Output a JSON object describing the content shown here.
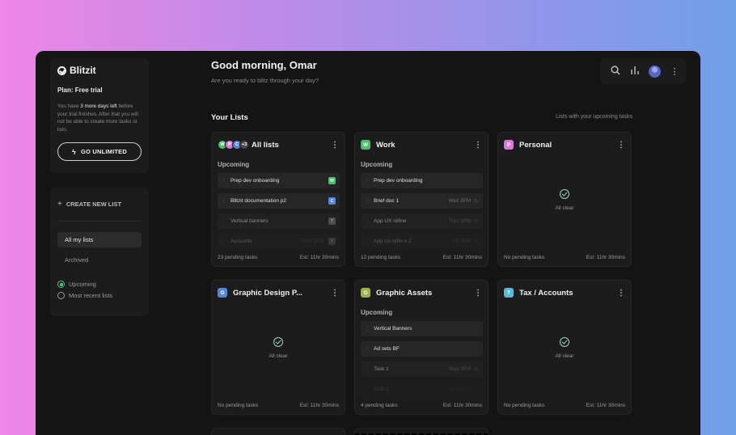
{
  "sidebar": {
    "brand": "Blitzit",
    "plan": "Plan: Free trial",
    "trial_pre": "You have ",
    "trial_days": "3 more days left",
    "trial_post": " before your trial finishes. After that you will not be able to create more tasks or lists.",
    "go_label": "GO UNLIMITED",
    "create_label": "CREATE NEW LIST",
    "nav": [
      "All my lists",
      "Archived"
    ],
    "sort_upcoming": "Upcoming",
    "sort_recent": "Most recent lists"
  },
  "header": {
    "greeting": "Good morning, Omar",
    "subtitle": "Are you ready to blitz through your day?",
    "lists_title": "Your Lists",
    "lists_link": "Lists with your upcoming tasks"
  },
  "cards": [
    {
      "title": "All lists",
      "avatars": [
        {
          "letter": "W",
          "color": "#4cbe6e"
        },
        {
          "letter": "P",
          "color": "#d77ad8"
        },
        {
          "letter": "C",
          "color": "#5a86d8"
        }
      ],
      "more": "+3",
      "upcoming": "Upcoming",
      "tasks": [
        {
          "name": "Prep dev onboarding",
          "due": "",
          "tag": "W",
          "tag_color": "#4cbe6e"
        },
        {
          "name": "Blitzit documentation p2",
          "due": "",
          "tag": "C",
          "tag_color": "#5a86d8"
        },
        {
          "name": "Vertical banners",
          "due": "",
          "tag": "T",
          "tag_color": "#777777"
        },
        {
          "name": "Accounts",
          "due": "Wed 3PM",
          "tag": "T",
          "tag_color": "#777777"
        }
      ],
      "pending": "23 pending tasks",
      "est": "Est: 11hr 30mins"
    },
    {
      "title": "Work",
      "badge": "W",
      "badge_color": "#4cbe6e",
      "upcoming": "Upcoming",
      "tasks": [
        {
          "name": "Prep dev onboarding",
          "due": ""
        },
        {
          "name": "Brief doc 1",
          "due": "Wed 3PM"
        },
        {
          "name": "App UX refine",
          "due": "Thur 3PM"
        },
        {
          "name": "App Ux refin e 2",
          "due": "Fri 3PM"
        }
      ],
      "pending": "12 pending tasks",
      "est": "Est: 11hr 30mins"
    },
    {
      "title": "Personal",
      "badge": "P",
      "badge_color": "#d77ad8",
      "clear": "All clear",
      "pending": "No pending tasks",
      "est": "Est: 11hr 30mins"
    },
    {
      "title": "Graphic Design P...",
      "badge": "G",
      "badge_color": "#5a86d8",
      "clear": "All clear",
      "pending": "No pending tasks",
      "est": "Est: 11hr 30mins"
    },
    {
      "title": "Graphic Assets",
      "badge": "G",
      "badge_color": "#9ab34a",
      "upcoming": "Upcoming",
      "tasks": [
        {
          "name": "Vertical Banners",
          "due": ""
        },
        {
          "name": "Ad sets BF",
          "due": ""
        },
        {
          "name": "Task 1",
          "due": "Wed 3PM"
        },
        {
          "name": "Task 1",
          "due": "Wed 3PM"
        }
      ],
      "pending": "4 pending tasks",
      "est": "Est: 11hr 30mins"
    },
    {
      "title": "Tax / Accounts",
      "badge": "T",
      "badge_color": "#5bb9d6",
      "clear": "All clear",
      "pending": "No pending tasks",
      "est": "Est: 11hr 30mins"
    }
  ]
}
